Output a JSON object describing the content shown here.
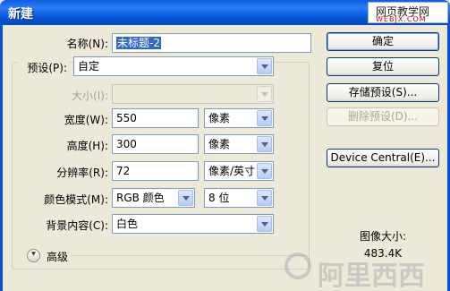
{
  "window": {
    "title": "新建"
  },
  "watermark": {
    "line1": "网页教学网",
    "line2": "WEBJX.COM"
  },
  "form": {
    "name_label": "名称(N):",
    "name_value": "未标题-2",
    "preset_label": "预设(P):",
    "preset_value": "自定",
    "size_label": "大小(I):",
    "size_value": "",
    "width_label": "宽度(W):",
    "width_value": "550",
    "width_unit": "像素",
    "height_label": "高度(H):",
    "height_value": "300",
    "height_unit": "像素",
    "resolution_label": "分辨率(R):",
    "resolution_value": "72",
    "resolution_unit": "像素/英寸",
    "color_mode_label": "颜色模式(M):",
    "color_mode_value": "RGB 颜色",
    "bit_depth_value": "8 位",
    "background_label": "背景内容(C):",
    "background_value": "白色",
    "advanced_label": "高级"
  },
  "buttons": {
    "ok": "确定",
    "reset": "复位",
    "save_preset": "存储预设(S)...",
    "delete_preset": "删除预设(D)...",
    "device_central": "Device Central(E)..."
  },
  "image_size": {
    "label": "图像大小:",
    "value": "483.4K"
  },
  "logo": {
    "text": "阿里西西"
  },
  "colors": {
    "title_bar": "#0A5FE0",
    "dialog_bg": "#ECE9D8",
    "selection": "#316AC5"
  },
  "icons": {
    "advanced": "chevron-double-down-icon"
  }
}
